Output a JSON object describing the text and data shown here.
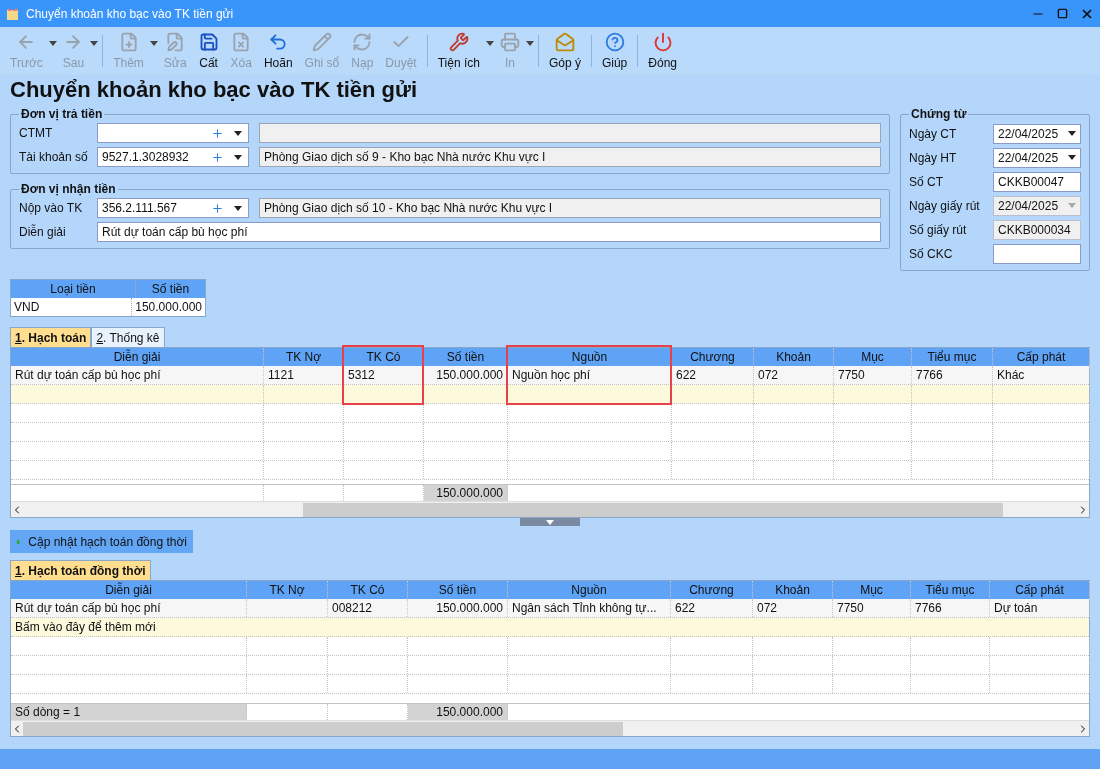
{
  "window": {
    "title": "Chuyển khoản kho bạc vào TK tiền gửi"
  },
  "toolbar": [
    {
      "label": "Trước",
      "disabled": true,
      "dropdown": true
    },
    {
      "label": "Sau",
      "disabled": true,
      "dropdown": true
    },
    {
      "label": "Thêm",
      "disabled": true,
      "dropdown": true
    },
    {
      "label": "Sửa",
      "disabled": true,
      "dropdown": false
    },
    {
      "label": "Cất",
      "disabled": false,
      "dropdown": false
    },
    {
      "label": "Xóa",
      "disabled": true,
      "dropdown": false
    },
    {
      "label": "Hoãn",
      "disabled": false,
      "dropdown": false
    },
    {
      "label": "Ghi sổ",
      "disabled": true,
      "dropdown": false
    },
    {
      "label": "Nạp",
      "disabled": true,
      "dropdown": false
    },
    {
      "label": "Duyệt",
      "disabled": true,
      "dropdown": false
    },
    {
      "label": "Tiện ích",
      "disabled": false,
      "dropdown": true
    },
    {
      "label": "In",
      "disabled": true,
      "dropdown": true
    },
    {
      "label": "Góp ý",
      "disabled": false,
      "dropdown": false
    },
    {
      "label": "Giúp",
      "disabled": false,
      "dropdown": false
    },
    {
      "label": "Đóng",
      "disabled": false,
      "dropdown": false
    }
  ],
  "page_title": "Chuyển khoản kho bạc vào TK tiền gửi",
  "payer": {
    "legend": "Đơn vị trả tiền",
    "fields": [
      {
        "label": "CTMT",
        "kind": "combo"
      },
      {
        "label": "Tài khoản số",
        "kind": "combo",
        "value": "9527.1.3028932",
        "name": "Phòng Giao dịch số 9 - Kho bạc Nhà nước Khu vực I"
      }
    ]
  },
  "payee": {
    "legend": "Đơn vị nhận tiền",
    "fields": [
      {
        "label": "Nộp vào TK",
        "kind": "combo",
        "value": "356.2.111.567",
        "name": "Phòng Giao dịch số 10 - Kho bạc Nhà nước Khu vực I"
      },
      {
        "label": "Diễn giải",
        "kind": "text",
        "value": "Rút dự toán cấp bù học phí"
      }
    ]
  },
  "voucher": {
    "legend": "Chứng từ",
    "fields": [
      {
        "label": "Ngày CT",
        "kind": "date",
        "value": "22/04/2025",
        "disabled": false
      },
      {
        "label": "Ngày HT",
        "kind": "date",
        "value": "22/04/2025",
        "disabled": false
      },
      {
        "label": "Số CT",
        "kind": "text",
        "value": "CKKB00047",
        "disabled": false
      },
      {
        "label": "Ngày giấy rút",
        "kind": "date",
        "value": "22/04/2025",
        "disabled": true
      },
      {
        "label": "Số giấy rút",
        "kind": "text",
        "value": "CKKB000034",
        "disabled": true
      },
      {
        "label": "Số CKC",
        "kind": "text",
        "disabled": false
      }
    ]
  },
  "currency_table": {
    "columns": [
      "Loại tiền",
      "Số tiền"
    ],
    "rows": [
      [
        "VND",
        "150.000.000"
      ]
    ]
  },
  "tabs": [
    {
      "label": "1. Hạch toán",
      "selected": true
    },
    {
      "label": "2. Thống kê",
      "selected": false
    }
  ],
  "grid": {
    "columns": [
      {
        "label": "Diễn giải"
      },
      {
        "label": "TK Nợ"
      },
      {
        "label": "TK Có",
        "highlighted": true
      },
      {
        "label": "Số tiền"
      },
      {
        "label": "Nguồn",
        "highlighted": true
      },
      {
        "label": "Chương"
      },
      {
        "label": "Khoản"
      },
      {
        "label": "Mục"
      },
      {
        "label": "Tiểu mục"
      },
      {
        "label": "Cấp phát"
      }
    ],
    "rows": [
      [
        "Rút dự toán cấp bù học phí",
        "1121",
        "5312",
        "150.000.000",
        "Nguồn học phí",
        "622",
        "072",
        "7750",
        "7766",
        "Khác"
      ]
    ],
    "footer": {
      "total": "150.000.000"
    }
  },
  "update_button": "Cập nhật hạch toán đồng thời",
  "tabs2": [
    {
      "label": "1. Hạch toán đồng thời",
      "selected": true
    }
  ],
  "grid2": {
    "columns": [
      {
        "label": "Diễn giải"
      },
      {
        "label": "TK Nợ"
      },
      {
        "label": "TK Có"
      },
      {
        "label": "Số tiền"
      },
      {
        "label": "Nguồn"
      },
      {
        "label": "Chương"
      },
      {
        "label": "Khoản"
      },
      {
        "label": "Mục"
      },
      {
        "label": "Tiểu mục"
      },
      {
        "label": "Cấp phát"
      }
    ],
    "rows": [
      [
        "Rút dự toán cấp bù học phí",
        "",
        "008212",
        "150.000.000",
        "Ngân sách Tỉnh không tự...",
        "622",
        "072",
        "7750",
        "7766",
        "Dự toán"
      ]
    ],
    "new_row": "Bấm vào đây để thêm mới",
    "footer": {
      "row_count": "Số dòng = 1",
      "total": "150.000.000"
    }
  }
}
